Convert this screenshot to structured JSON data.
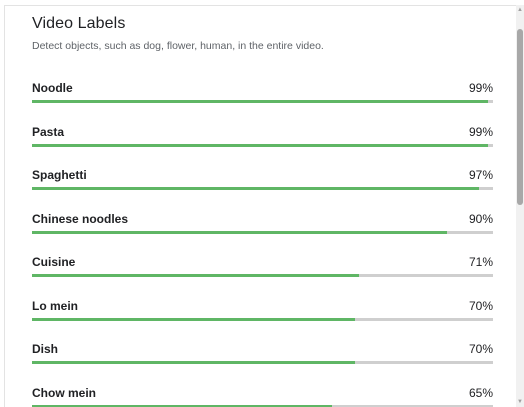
{
  "panel": {
    "title": "Video Labels",
    "subtitle": "Detect objects, such as dog, flower, human, in the entire video."
  },
  "labels": [
    {
      "name": "Noodle",
      "confidence_text": "99%",
      "confidence": 0.99
    },
    {
      "name": "Pasta",
      "confidence_text": "99%",
      "confidence": 0.99
    },
    {
      "name": "Spaghetti",
      "confidence_text": "97%",
      "confidence": 0.97
    },
    {
      "name": "Chinese noodles",
      "confidence_text": "90%",
      "confidence": 0.9
    },
    {
      "name": "Cuisine",
      "confidence_text": "71%",
      "confidence": 0.71
    },
    {
      "name": "Lo mein",
      "confidence_text": "70%",
      "confidence": 0.7
    },
    {
      "name": "Dish",
      "confidence_text": "70%",
      "confidence": 0.7
    },
    {
      "name": "Chow mein",
      "confidence_text": "65%",
      "confidence": 0.65
    }
  ],
  "scrollbar": {
    "up_icon": "triangle-up-icon",
    "down_icon": "triangle-down-icon"
  },
  "colors": {
    "bar_fill": "#5fb665",
    "bar_track": "#cfcfcf",
    "text": "#202124",
    "muted": "#5f6368"
  }
}
